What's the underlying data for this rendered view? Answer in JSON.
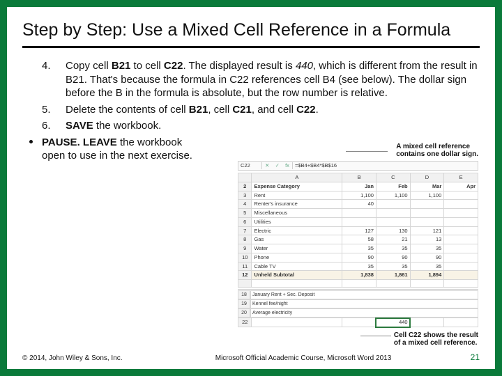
{
  "title": "Step by Step: Use a Mixed Cell Reference in a Formula",
  "steps": {
    "s4_num": "4.",
    "s4_a": "Copy cell ",
    "s4_b": "B21",
    "s4_c": " to cell ",
    "s4_d": "C22",
    "s4_e": ". The displayed result is ",
    "s4_f": "440",
    "s4_g": ", which is different from the result in B21. That's because the formula in C22 references cell B4 (see below). The dollar sign before the B in the formula is absolute, but the row number is relative.",
    "s5_num": "5.",
    "s5_a": "Delete the contents of cell ",
    "s5_b": "B21",
    "s5_c": ", cell ",
    "s5_d": "C21",
    "s5_e": ", and cell ",
    "s5_f": "C22",
    "s5_g": ".",
    "s6_num": "6.",
    "s6_a": "SAVE",
    "s6_b": " the workbook.",
    "pause_a": "PAUSE. LEAVE",
    "pause_b": " the workbook open to use in the next exercise."
  },
  "callout1_l1": "A mixed cell reference",
  "callout1_l2": "contains one dollar sign.",
  "callout2_l1": "Cell C22 shows the result",
  "callout2_l2": "of a mixed cell reference.",
  "formula": {
    "ref": "C22",
    "x": "✕",
    "chk": "✓",
    "fx": "fx",
    "text": "=$B4+$B4*$B$16"
  },
  "sheet": {
    "cols": [
      "",
      "A",
      "B",
      "C",
      "D",
      "E"
    ],
    "rows": [
      {
        "rh": "2",
        "a": "Expense Category",
        "b": "Jan",
        "c": "Feb",
        "d": "Mar",
        "e": "Apr",
        "cls": "monthhdr"
      },
      {
        "rh": "3",
        "a": "Rent",
        "b": "1,100",
        "c": "1,100",
        "d": "1,100",
        "e": ""
      },
      {
        "rh": "4",
        "a": "Renter's insurance",
        "b": "40",
        "c": "",
        "d": "",
        "e": ""
      },
      {
        "rh": "5",
        "a": "Miscellaneous",
        "b": "",
        "c": "",
        "d": "",
        "e": ""
      },
      {
        "rh": "6",
        "a": "Utilities",
        "b": "",
        "c": "",
        "d": "",
        "e": ""
      },
      {
        "rh": "7",
        "a": "  Electric",
        "b": "127",
        "c": "130",
        "d": "121",
        "e": ""
      },
      {
        "rh": "8",
        "a": "  Gas",
        "b": "58",
        "c": "21",
        "d": "13",
        "e": ""
      },
      {
        "rh": "9",
        "a": "  Water",
        "b": "35",
        "c": "35",
        "d": "35",
        "e": ""
      },
      {
        "rh": "10",
        "a": "  Phone",
        "b": "90",
        "c": "90",
        "d": "90",
        "e": ""
      },
      {
        "rh": "11",
        "a": "  Cable TV",
        "b": "35",
        "c": "35",
        "d": "35",
        "e": ""
      },
      {
        "rh": "12",
        "a": "Unheld Subtotal",
        "b": "1,838",
        "c": "1,861",
        "d": "1,894",
        "e": "",
        "cls": "totals"
      },
      {
        "rh": "",
        "a": "",
        "b": "",
        "c": "",
        "d": "",
        "e": ""
      }
    ],
    "lower": [
      {
        "rh": "18",
        "a": "January Rent + Sec. Deposit",
        "b": ""
      },
      {
        "rh": "19",
        "a": "Kennel fee/night",
        "b": ""
      },
      {
        "rh": "20",
        "a": "Average electricity",
        "b": ""
      }
    ],
    "selrow": {
      "rh": "22",
      "a": "",
      "b": "",
      "c": "440",
      "d": "",
      "e": ""
    }
  },
  "footer": {
    "left": "© 2014, John Wiley & Sons, Inc.",
    "mid": "Microsoft Official Academic Course, Microsoft Word 2013",
    "page": "21"
  }
}
